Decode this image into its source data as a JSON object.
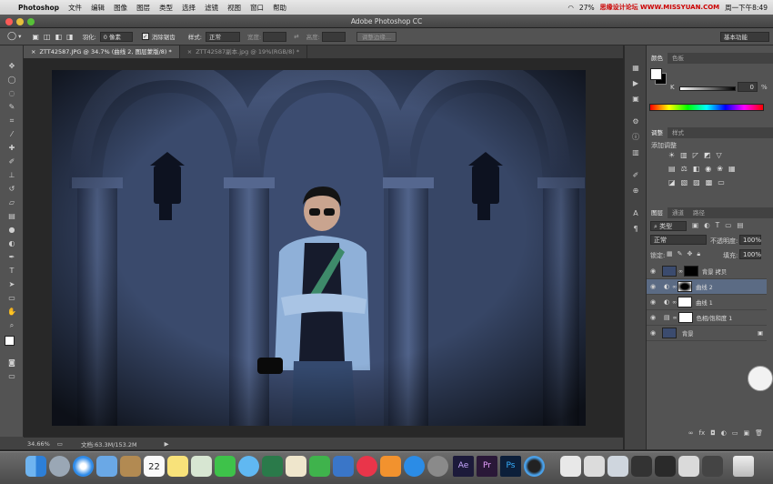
{
  "menubar": {
    "apple": "",
    "app": "Photoshop",
    "items": [
      "文件",
      "编辑",
      "图像",
      "图层",
      "类型",
      "选择",
      "滤镜",
      "视图",
      "窗口",
      "帮助"
    ],
    "battery": "27%",
    "watermark": "思缘设计论坛 WWW.MISSYUAN.COM",
    "clock": "周一下午8:49"
  },
  "window": {
    "title": "Adobe Photoshop CC"
  },
  "options": {
    "feather_label": "羽化:",
    "feather_value": "0 像素",
    "antialias_label": "消除锯齿",
    "style_label": "样式:",
    "style_value": "正常",
    "width_label": "宽度:",
    "height_label": "高度:",
    "refine_button": "调整边缘...",
    "workspace": "基本功能"
  },
  "tabs": [
    {
      "label": "ZTT42587.JPG @ 34.7% (曲线 2, 图层蒙版/8) *",
      "close": "×"
    },
    {
      "label": "ZTT42587副本.jpg @ 19%(RGB/8) *",
      "close": "×"
    }
  ],
  "status": {
    "zoom": "34.66%",
    "doc": "文档:63.3M/153.2M",
    "arrow": "▶"
  },
  "color_panel": {
    "tabs": [
      "颜色",
      "色板"
    ],
    "channel": "K",
    "value": "0",
    "unit": "%"
  },
  "adjust_panel": {
    "tabs": [
      "调整",
      "样式"
    ],
    "label": "添加调整"
  },
  "layers_panel": {
    "tabs": [
      "图层",
      "通道",
      "路径"
    ],
    "filter": "类型",
    "blend": "正常",
    "opacity_label": "不透明度:",
    "opacity": "100%",
    "lock_label": "锁定:",
    "fill_label": "填充:",
    "fill": "100%",
    "layers": [
      {
        "name": "背景 拷贝"
      },
      {
        "name": "曲线 2"
      },
      {
        "name": "曲线 1"
      },
      {
        "name": "色相/饱和度 1"
      },
      {
        "name": "背景"
      }
    ]
  },
  "colors": {
    "accent": "#5b6b84",
    "panel": "#535353",
    "bg": "#282828"
  }
}
